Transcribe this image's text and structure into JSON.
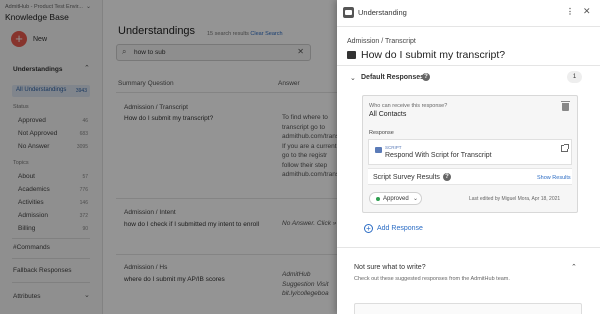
{
  "sidebar": {
    "org": "AdmitHub - Product Test Envir...",
    "title": "Knowledge Base",
    "new_label": "New",
    "understandings_label": "Understandings",
    "all_understandings": {
      "label": "All Understandings",
      "count": "3943"
    },
    "status_header": "Status",
    "status_items": [
      {
        "label": "Approved",
        "count": "46"
      },
      {
        "label": "Not Approved",
        "count": "683"
      },
      {
        "label": "No Answer",
        "count": "3095"
      }
    ],
    "topics_header": "Topics",
    "topic_items": [
      {
        "label": "About",
        "count": "57"
      },
      {
        "label": "Academics",
        "count": "776"
      },
      {
        "label": "Activities",
        "count": "146"
      },
      {
        "label": "Admission",
        "count": "372"
      },
      {
        "label": "Billing",
        "count": "90"
      }
    ],
    "commands": "#Commands",
    "fallback": "Fallback Responses",
    "attributes": "Attributes"
  },
  "main": {
    "title": "Understandings",
    "results": "15 search results",
    "clear": "Clear Search",
    "search_value": "how to sub",
    "col_question": "Summary Question",
    "col_answer": "Answer",
    "rows": [
      {
        "category": "Admission / Transcript",
        "question": "How do I submit my transcript?",
        "answer": "To find where to transcript go to admithub.com/trans If you are a current go to the registr follow their step admithub.com/trans"
      },
      {
        "category": "Admission / Intent",
        "question": "how do I check if I submitted my intent to enroll",
        "answer": "No Answer. Click »"
      },
      {
        "category": "Admission / Hs",
        "question": "where do I submit my AP/IB scores",
        "answer": "AdmitHub Suggestion Visit bit.ly/collegeboa"
      }
    ]
  },
  "drawer": {
    "title": "Understanding",
    "breadcrumb": "Admission / Transcript",
    "question": "How do I submit my transcript?",
    "default_responses": "Default Responses",
    "response_count": "1",
    "who_label": "Who can receive this response?",
    "who_value": "All Contacts",
    "response_label": "Response",
    "script_tag": "SCRIPT",
    "script_name": "Respond With Script for Transcript",
    "survey_label": "Script Survey Results",
    "show_results": "Show Results",
    "status": "Approved",
    "last_edited": "Last edited by Miguel Mora, Apr 18, 2021",
    "add_response": "Add Response",
    "not_sure_title": "Not sure what to write?",
    "not_sure_sub": "Check out these suggested responses from the AdmitHub team."
  },
  "colors": {
    "accent": "#2b6cc4",
    "new_button": "#e85a4f",
    "approved": "#2e9e4f"
  }
}
